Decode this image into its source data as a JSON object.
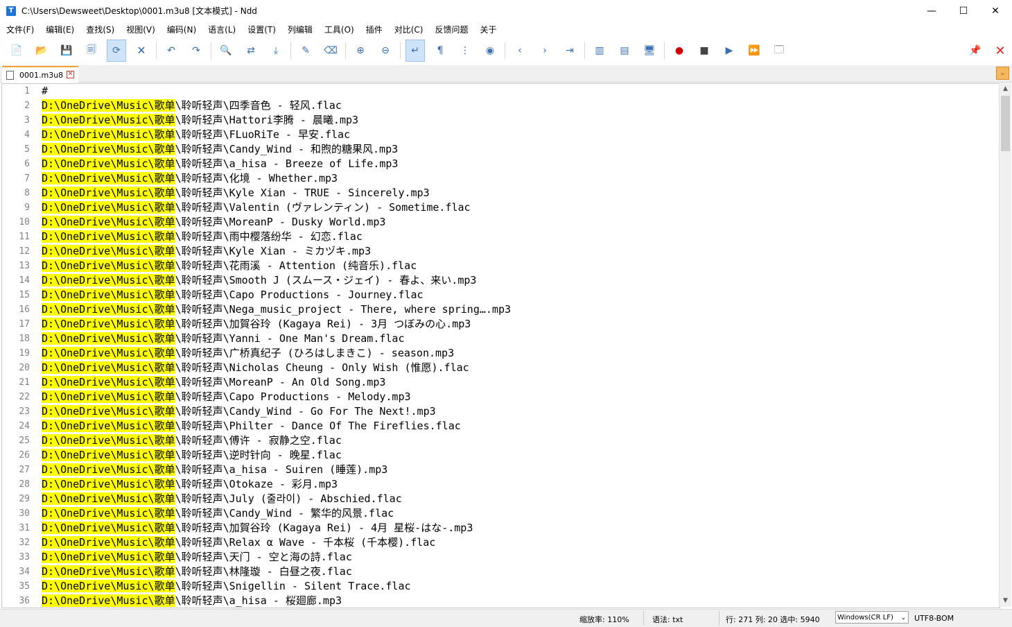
{
  "window": {
    "title": "C:\\Users\\Dewsweet\\Desktop\\0001.m3u8 [文本模式] - Ndd",
    "app_icon_letter": "T",
    "controls": [
      "—",
      "☐",
      "✕"
    ]
  },
  "menu": [
    "文件(F)",
    "编辑(E)",
    "查找(S)",
    "视图(V)",
    "编码(N)",
    "语言(L)",
    "设置(T)",
    "列编辑",
    "工具(O)",
    "插件",
    "对比(C)",
    "反馈问题",
    "关于"
  ],
  "toolbar_icons": {
    "new": "📄",
    "open": "📂",
    "save": "💾",
    "save_all": "🗐",
    "auto_save": "⟳",
    "close": "🗙",
    "undo": "↶",
    "redo": "↷",
    "find": "🔍",
    "replace": "⇄",
    "goto": "⤓",
    "mark": "✎",
    "clear_mark": "⌫",
    "zoom_in": "⊕",
    "zoom_out": "⊖",
    "wrap": "↵",
    "show_symbols": "¶",
    "indent_guide": "⋮",
    "focus": "◉",
    "prev": "‹",
    "next": "›",
    "go": "⇥",
    "split_h": "▥",
    "split_v": "▤",
    "monitor": "🖥",
    "record": "●",
    "stop": "■",
    "play": "▶",
    "play_multi": "⏩",
    "save_macro": "🗔",
    "pin": "📌",
    "close_x": "✕"
  },
  "tabs": [
    {
      "label": "0001.m3u8",
      "close": "✕"
    }
  ],
  "tab_dropdown": "⌄",
  "editor": {
    "prefix": "D:\\OneDrive\\Music\\歌单",
    "lines": [
      "#",
      "\\聆听轻声\\四季音色 - 轻风.flac",
      "\\聆听轻声\\Hattori李腾 - 晨曦.mp3",
      "\\聆听轻声\\FLuoRiTe - 早安.flac",
      "\\聆听轻声\\Candy_Wind - 和煦的糖果风.mp3",
      "\\聆听轻声\\a_hisa - Breeze of Life.mp3",
      "\\聆听轻声\\化境 - Whether.mp3",
      "\\聆听轻声\\Kyle Xian - TRUE - Sincerely.mp3",
      "\\聆听轻声\\Valentin (ヴァレンティン) - Sometime.flac",
      "\\聆听轻声\\MoreanP - Dusky World.mp3",
      "\\聆听轻声\\雨中樱落纷华 - 幻恋.flac",
      "\\聆听轻声\\Kyle Xian - ミカヅキ.mp3",
      "\\聆听轻声\\花雨溪 - Attention (纯音乐).flac",
      "\\聆听轻声\\Smooth J (スムース・ジェイ) - 春よ、来い.mp3",
      "\\聆听轻声\\Capo Productions - Journey.flac",
      "\\聆听轻声\\Nega_music_project - There, where spring….mp3",
      "\\聆听轻声\\加賀谷玲 (Kagaya Rei) - 3月 つぼみの心.mp3",
      "\\聆听轻声\\Yanni - One Man's Dream.flac",
      "\\聆听轻声\\广桥真纪子 (ひろはしまきこ) - season.mp3",
      "\\聆听轻声\\Nicholas Cheung - Only Wish (惟愿).flac",
      "\\聆听轻声\\MoreanP - An Old Song.mp3",
      "\\聆听轻声\\Capo Productions - Melody.mp3",
      "\\聆听轻声\\Candy_Wind - Go For The Next!.mp3",
      "\\聆听轻声\\Philter - Dance Of The Fireflies.flac",
      "\\聆听轻声\\傅许 - 寂静之空.flac",
      "\\聆听轻声\\逆时针向 - 晚星.flac",
      "\\聆听轻声\\a_hisa - Suiren (睡莲).mp3",
      "\\聆听轻声\\Otokaze - 彩月.mp3",
      "\\聆听轻声\\July (줄라이) - Abschied.flac",
      "\\聆听轻声\\Candy_Wind - 繁华的风景.flac",
      "\\聆听轻声\\加賀谷玲 (Kagaya Rei) - 4月 星桜-はな-.mp3",
      "\\聆听轻声\\Relax α Wave - 千本桜 (千本樱).flac",
      "\\聆听轻声\\天门 - 空と海の詩.flac",
      "\\聆听轻声\\林隆璇 - 白昼之夜.flac",
      "\\聆听轻声\\Snigellin - Silent Trace.flac",
      "\\聆听轻声\\a_hisa - 桜廻廊.mp3"
    ]
  },
  "scrollbar": {
    "up": "▲",
    "down": "▼"
  },
  "status": {
    "zoom": "缩放率: 110%",
    "syntax": "语法: txt",
    "position": "行: 271 列: 20 选中: 5940",
    "eol": "Windows(CR LF)",
    "eol_arrow": "⌄",
    "encoding": "UTF8-BOM"
  }
}
